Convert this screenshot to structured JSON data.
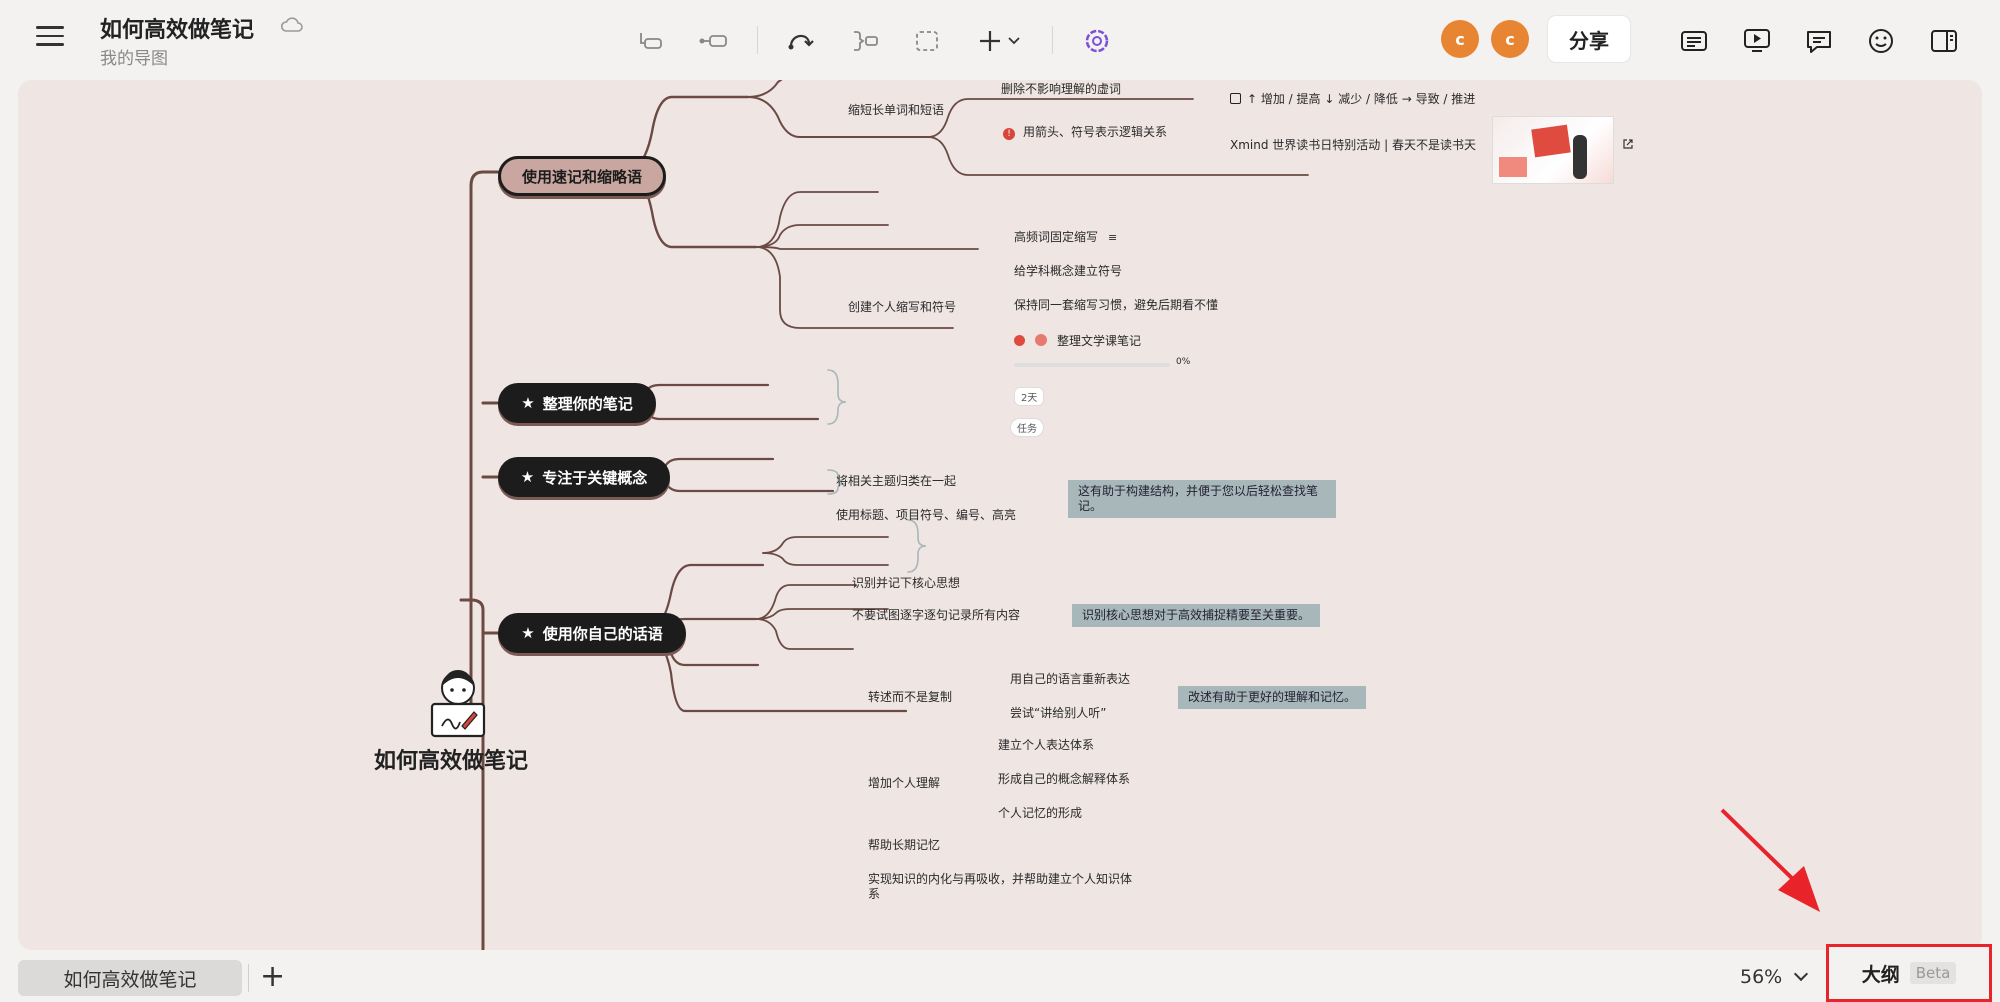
{
  "header": {
    "title": "如何高效做笔记",
    "subtitle": "我的导图",
    "avatars": [
      "c",
      "c"
    ],
    "share_label": "分享"
  },
  "toolbar_icons": [
    "topic-icon",
    "subtopic-icon",
    "relationship-icon",
    "summary-icon",
    "boundary-icon",
    "insert-icon",
    "ai-icon"
  ],
  "right_icons": [
    "format-icon",
    "presentation-icon",
    "comment-icon",
    "emoji-icon",
    "panel-icon"
  ],
  "mindmap": {
    "root": "如何高效做笔记",
    "topics": [
      "使用速记和缩略语",
      "整理你的笔记",
      "专注于关键概念",
      "使用你自己的话语"
    ],
    "t1": {
      "sub1": "缩短长单词和短语",
      "sub1_a": "删除不影响理解的虚词",
      "sub1_b": "用箭头、符号表示逻辑关系",
      "sub1_b1": "↑ 增加 / 提高 ↓ 减少 / 降低 → 导致 / 推进",
      "sub1_b2": "Xmind 世界读书日特别活动 | 春天不是读书天",
      "sub2": "创建个人缩写和符号",
      "sub2_a": "高频词固定缩写",
      "sub2_b": "给学科概念建立符号",
      "sub2_c": "保持同一套缩写习惯，避免后期看不懂",
      "sub2_d": "整理文学课笔记",
      "progress": "0%",
      "days": "2天",
      "task": "任务"
    },
    "t2": {
      "sub1": "将相关主题归类在一起",
      "sub2": "使用标题、项目符号、编号、高亮",
      "summary": "这有助于构建结构，并便于您以后轻松查找笔记。"
    },
    "t3": {
      "sub1": "识别并记下核心思想",
      "sub2": "不要试图逐字逐句记录所有内容",
      "summary": "识别核心思想对于高效捕捉精要至关重要。"
    },
    "t4": {
      "sub1": "转述而不是复制",
      "sub1_a": "用自己的语言重新表达",
      "sub1_b": "尝试“讲给别人听”",
      "summary": "改述有助于更好的理解和记忆。",
      "sub2": "增加个人理解",
      "sub2_a": "建立个人表达体系",
      "sub2_b": "形成自己的概念解释体系",
      "sub2_c": "个人记忆的形成",
      "sub3": "帮助长期记忆",
      "sub4": "实现知识的内化与再吸收，并帮助建立个人知识体系"
    }
  },
  "footer": {
    "sheet_tab": "如何高效做笔记",
    "zoom": "56%",
    "outline_label": "大纲",
    "outline_badge": "Beta"
  },
  "colors": {
    "accent": "#e88532",
    "highlight": "#e8242a",
    "branch": "#6b4a44"
  }
}
